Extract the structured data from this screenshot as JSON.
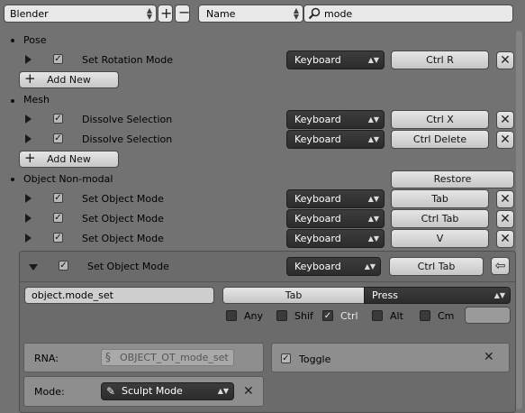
{
  "header": {
    "preset": "Blender",
    "add_icon": "plus-icon",
    "remove_icon": "minus-icon",
    "filter_type": "Name",
    "search_value": "mode"
  },
  "sections": {
    "pose": {
      "title": "Pose",
      "item": {
        "name": "Set Rotation Mode",
        "input": "Keyboard",
        "key": "Ctrl R"
      },
      "add_new": "Add New"
    },
    "mesh": {
      "title": "Mesh",
      "items": [
        {
          "name": "Dissolve Selection",
          "input": "Keyboard",
          "key": "Ctrl X"
        },
        {
          "name": "Dissolve Selection",
          "input": "Keyboard",
          "key": "Ctrl Delete"
        }
      ],
      "add_new": "Add New"
    },
    "object": {
      "title": "Object Non-modal",
      "restore": "Restore",
      "items": [
        {
          "name": "Set Object Mode",
          "input": "Keyboard",
          "key": "Tab"
        },
        {
          "name": "Set Object Mode",
          "input": "Keyboard",
          "key": "Ctrl Tab"
        },
        {
          "name": "Set Object Mode",
          "input": "Keyboard",
          "key": "V"
        }
      ],
      "expanded": {
        "name": "Set Object Mode",
        "input": "Keyboard",
        "key": "Ctrl Tab",
        "operator": "object.mode_set",
        "key_type": "Tab",
        "event": "Press",
        "modifiers": {
          "any": "Any",
          "shift": "Shif",
          "ctrl": "Ctrl",
          "alt": "Alt",
          "cmd": "Cm"
        },
        "rna_label": "RNA:",
        "rna_value": "OBJECT_OT_mode_set",
        "toggle_label": "Toggle",
        "mode_label": "Mode:",
        "mode_value": "Sculpt Mode"
      }
    }
  }
}
